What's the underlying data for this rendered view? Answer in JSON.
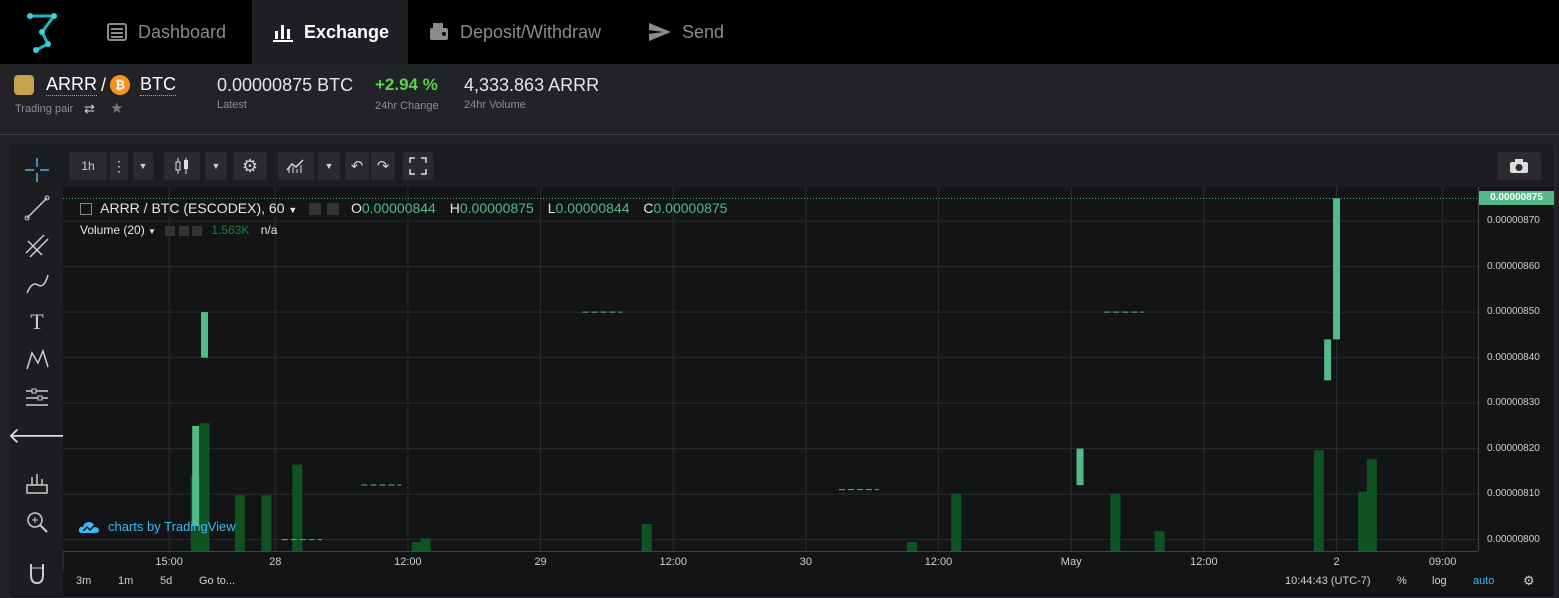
{
  "nav": {
    "items": [
      {
        "label": "Dashboard",
        "icon": "dashboard-icon"
      },
      {
        "label": "Exchange",
        "icon": "bar-chart-icon",
        "active": true
      },
      {
        "label": "Deposit/Withdraw",
        "icon": "wallet-icon"
      },
      {
        "label": "Send",
        "icon": "send-icon"
      }
    ]
  },
  "pair": {
    "base": "ARRR",
    "sep": "/",
    "quote": "BTC",
    "sub_label": "Trading pair",
    "latest_value": "0.00000875 BTC",
    "latest_label": "Latest",
    "change_value": "+2.94 %",
    "change_label": "24hr Change",
    "volume_value": "4,333.863 ARRR",
    "volume_label": "24hr Volume"
  },
  "toolbar": {
    "interval": "1h"
  },
  "chart_legend": {
    "symbol": "ARRR / BTC (ESCODEX), 60",
    "o_label": "O",
    "o": "0.00000844",
    "h_label": "H",
    "h": "0.00000875",
    "l_label": "L",
    "l": "0.00000844",
    "c_label": "C",
    "c": "0.00000875",
    "volume_label": "Volume (20)",
    "volume_value": "1.563K",
    "volume_na": "n/a",
    "watermark": "charts by TradingView"
  },
  "bottom": {
    "ranges": [
      "3m",
      "1m",
      "5d"
    ],
    "goto": "Go to...",
    "clock": "10:44:43 (UTC-7)",
    "percent": "%",
    "log": "log",
    "auto": "auto"
  },
  "colors": {
    "up": "#53b987",
    "volume": "#0f5323",
    "accent": "#3bbaf0"
  },
  "chart_data": {
    "type": "candlestick",
    "price_ticks": [
      "0.00000870",
      "0.00000860",
      "0.00000850",
      "0.00000840",
      "0.00000830",
      "0.00000820",
      "0.00000810",
      "0.00000800"
    ],
    "last_price_label": "0.00000875",
    "ylim": [
      7.975e-06,
      8.775e-06
    ],
    "time_ticks": [
      "15:00",
      "28",
      "12:00",
      "29",
      "12:00",
      "30",
      "12:00",
      "May",
      "12:00",
      "2",
      "09:00"
    ],
    "candles": [
      {
        "t": 15.0,
        "o": 8.03e-06,
        "h": 8.25e-06,
        "l": 8.03e-06,
        "c": 8.25e-06
      },
      {
        "t": 16.0,
        "o": 8.4e-06,
        "h": 8.5e-06,
        "l": 8.4e-06,
        "c": 8.5e-06
      },
      {
        "t": 27.0,
        "o": 8e-06,
        "h": 8e-06,
        "l": 8e-06,
        "c": 8e-06
      },
      {
        "t": 36.0,
        "o": 8.12e-06,
        "h": 8.12e-06,
        "l": 8.12e-06,
        "c": 8.12e-06
      },
      {
        "t": 61.0,
        "o": 8.5e-06,
        "h": 8.5e-06,
        "l": 8.5e-06,
        "c": 8.5e-06
      },
      {
        "t": 90.0,
        "o": 8.11e-06,
        "h": 8.11e-06,
        "l": 8.11e-06,
        "c": 8.11e-06
      },
      {
        "t": 115.0,
        "o": 8.12e-06,
        "h": 8.2e-06,
        "l": 8.12e-06,
        "c": 8.2e-06
      },
      {
        "t": 120.0,
        "o": 8.5e-06,
        "h": 8.5e-06,
        "l": 8.5e-06,
        "c": 8.5e-06
      },
      {
        "t": 143.0,
        "o": 8.35e-06,
        "h": 8.44e-06,
        "l": 8.35e-06,
        "c": 8.44e-06
      },
      {
        "t": 144.0,
        "o": 8.44e-06,
        "h": 8.75e-06,
        "l": 8.44e-06,
        "c": 8.75e-06
      }
    ],
    "volumes": [
      {
        "t": 15.0,
        "v": 0.42
      },
      {
        "t": 16.0,
        "v": 0.71
      },
      {
        "t": 20.0,
        "v": 0.31
      },
      {
        "t": 23.0,
        "v": 0.31
      },
      {
        "t": 26.5,
        "v": 0.48
      },
      {
        "t": 40.0,
        "v": 0.05
      },
      {
        "t": 41.0,
        "v": 0.07
      },
      {
        "t": 66.0,
        "v": 0.15
      },
      {
        "t": 96.0,
        "v": 0.05
      },
      {
        "t": 101.0,
        "v": 0.32
      },
      {
        "t": 119.0,
        "v": 0.32
      },
      {
        "t": 124.0,
        "v": 0.11
      },
      {
        "t": 142.0,
        "v": 0.56
      },
      {
        "t": 147.0,
        "v": 0.33
      },
      {
        "t": 148.0,
        "v": 0.51
      }
    ]
  }
}
